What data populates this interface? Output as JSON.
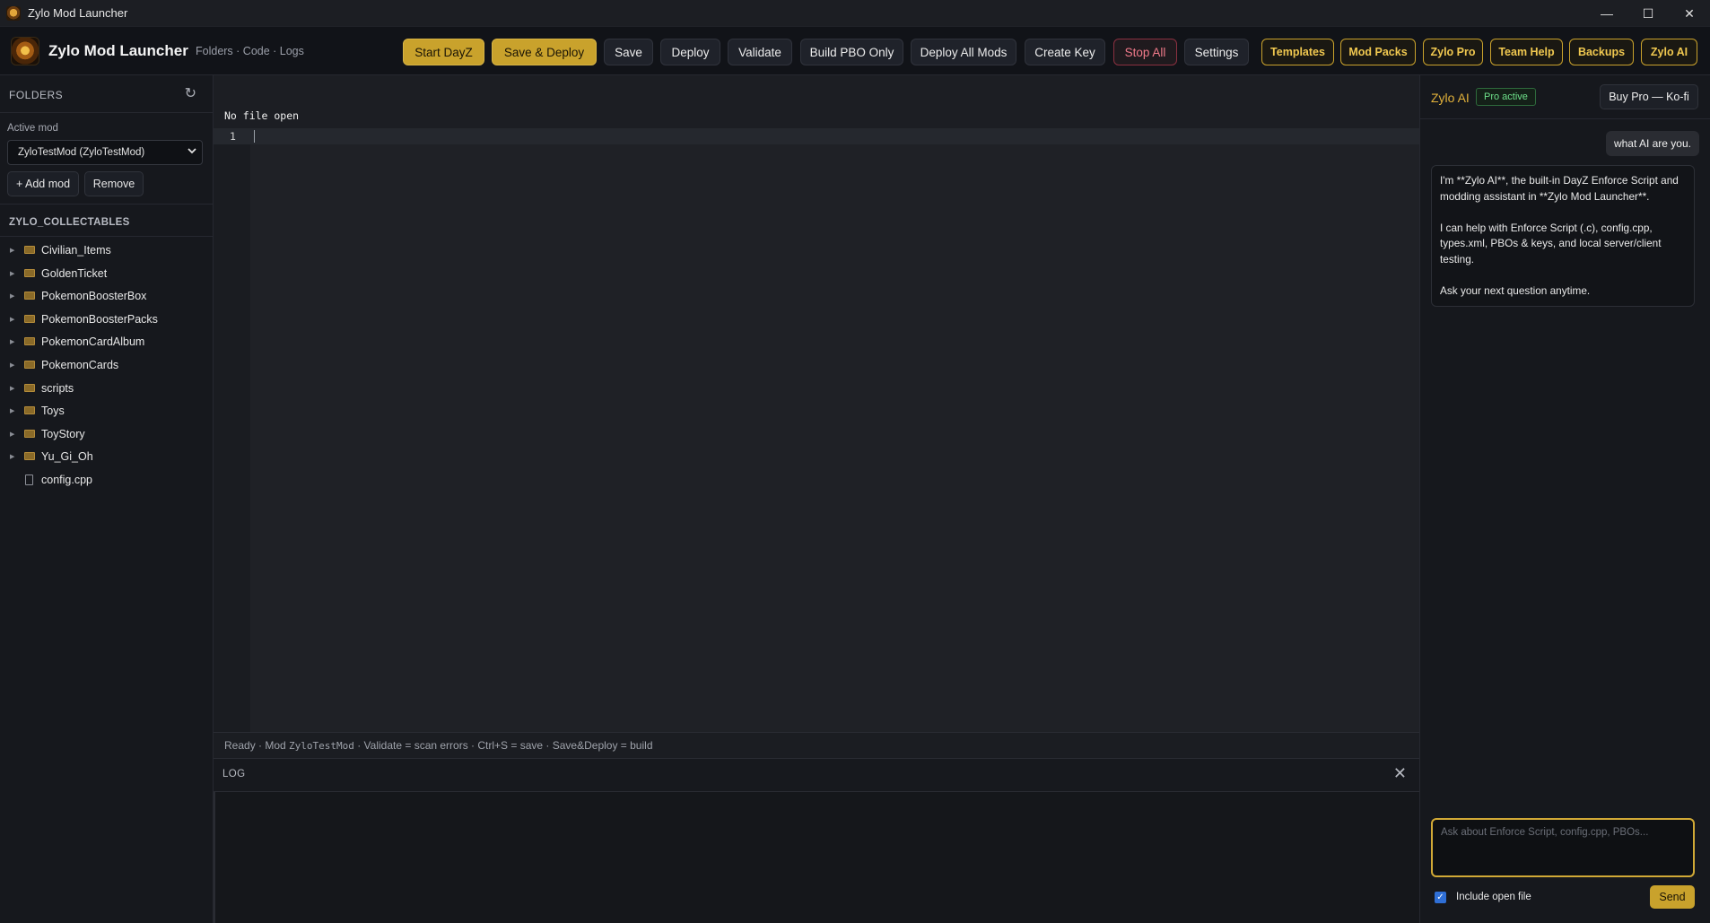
{
  "window": {
    "title": "Zylo Mod Launcher",
    "minimize": "—",
    "maximize": "☐",
    "close": "✕"
  },
  "header": {
    "brand": "Zylo Mod Launcher",
    "crumbs": "Folders · Code · Logs",
    "buttons": {
      "start_dayz": "Start DayZ",
      "save_deploy": "Save & Deploy",
      "save": "Save",
      "deploy": "Deploy",
      "validate": "Validate",
      "build_pbo": "Build PBO Only",
      "deploy_all": "Deploy All Mods",
      "create_key": "Create Key",
      "stop_all": "Stop All",
      "settings": "Settings",
      "templates": "Templates",
      "mod_packs": "Mod Packs",
      "zylo_pro": "Zylo Pro",
      "team_help": "Team Help",
      "backups": "Backups",
      "zylo_ai": "Zylo AI"
    }
  },
  "sidebar": {
    "heading": "FOLDERS",
    "refresh": "↻",
    "active_mod_label": "Active mod",
    "active_mod_value": "ZyloTestMod (ZyloTestMod)",
    "add_mod": "+ Add mod",
    "remove": "Remove",
    "tree_title": "ZYLO_COLLECTABLES",
    "tree": [
      {
        "name": "Civilian_Items",
        "type": "folder"
      },
      {
        "name": "GoldenTicket",
        "type": "folder"
      },
      {
        "name": "PokemonBoosterBox",
        "type": "folder"
      },
      {
        "name": "PokemonBoosterPacks",
        "type": "folder"
      },
      {
        "name": "PokemonCardAlbum",
        "type": "folder"
      },
      {
        "name": "PokemonCards",
        "type": "folder"
      },
      {
        "name": "scripts",
        "type": "folder"
      },
      {
        "name": "Toys",
        "type": "folder"
      },
      {
        "name": "ToyStory",
        "type": "folder"
      },
      {
        "name": "Yu_Gi_Oh",
        "type": "folder"
      },
      {
        "name": "config.cpp",
        "type": "file"
      }
    ]
  },
  "editor": {
    "no_file": "No file open",
    "line_number": "1"
  },
  "status": {
    "part1": "Ready · Mod ",
    "mod_name": "ZyloTestMod",
    "part2": " · Validate = scan errors · Ctrl+S = save · Save&Deploy = build"
  },
  "log": {
    "title": "LOG",
    "close": "✕"
  },
  "ai": {
    "title": "Zylo AI",
    "badge": "Pro active",
    "buy": "Buy Pro — Ko-fi",
    "user_message": "what AI are you.",
    "bot_p1": "I'm **Zylo AI**, the built-in DayZ Enforce Script and modding assistant in **Zylo Mod Launcher**.",
    "bot_p2": "I can help with Enforce Script (.c), config.cpp, types.xml, PBOs & keys, and local server/client testing.",
    "bot_p3": "Ask your next question anytime.",
    "input_placeholder": "Ask about Enforce Script, config.cpp, PBOs...",
    "include_open_file": "Include open file",
    "send": "Send"
  }
}
